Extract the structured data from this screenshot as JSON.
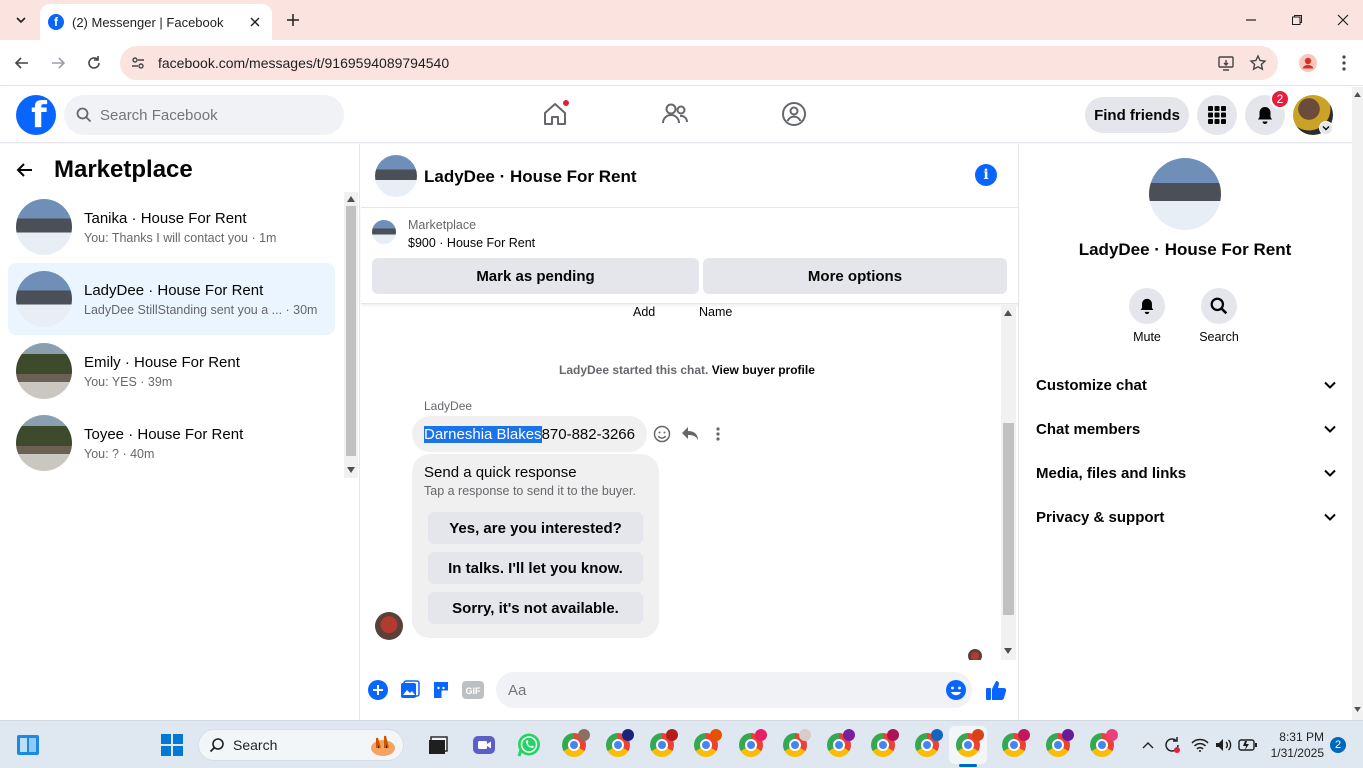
{
  "browser": {
    "tab_title": "(2) Messenger | Facebook",
    "url": "facebook.com/messages/t/9169594089794540"
  },
  "fbnav": {
    "search_placeholder": "Search Facebook",
    "find_friends": "Find friends",
    "notification_count": "2"
  },
  "sidebar": {
    "title": "Marketplace",
    "conversations": [
      {
        "name": "Tanika · House For Rent",
        "preview": "You: Thanks I will contact you · 1m"
      },
      {
        "name": "LadyDee · House For Rent",
        "preview": "LadyDee StillStanding sent you a ... · 30m"
      },
      {
        "name": "Emily · House For Rent",
        "preview": "You: YES · 39m"
      },
      {
        "name": "Toyee · House For Rent",
        "preview": "You: ? · 40m"
      }
    ]
  },
  "chat": {
    "title": "LadyDee · House For Rent",
    "listing_source": "Marketplace",
    "listing_price": "$900 · House For Rent",
    "mark_pending": "Mark as pending",
    "more_options": "More options",
    "add_label": "Add",
    "name_label": "Name",
    "system_message": "LadyDee started this chat.",
    "view_buyer": "View buyer profile",
    "sender": "LadyDee",
    "message_highlight": "Darneshia Blakes",
    "message_rest": " 870-882-3266",
    "quick_title": "Send a quick response",
    "quick_sub": "Tap a response to send it to the buyer.",
    "quick_responses": [
      "Yes, are you interested?",
      "In talks. I'll let you know.",
      "Sorry, it's not available."
    ],
    "composer_placeholder": "Aa"
  },
  "details": {
    "name": "LadyDee · House For Rent",
    "mute": "Mute",
    "search": "Search",
    "sections": [
      "Customize chat",
      "Chat members",
      "Media, files and links",
      "Privacy & support"
    ]
  },
  "taskbar": {
    "search": "Search",
    "time": "8:31 PM",
    "date": "1/31/2025",
    "notifications": "2"
  }
}
